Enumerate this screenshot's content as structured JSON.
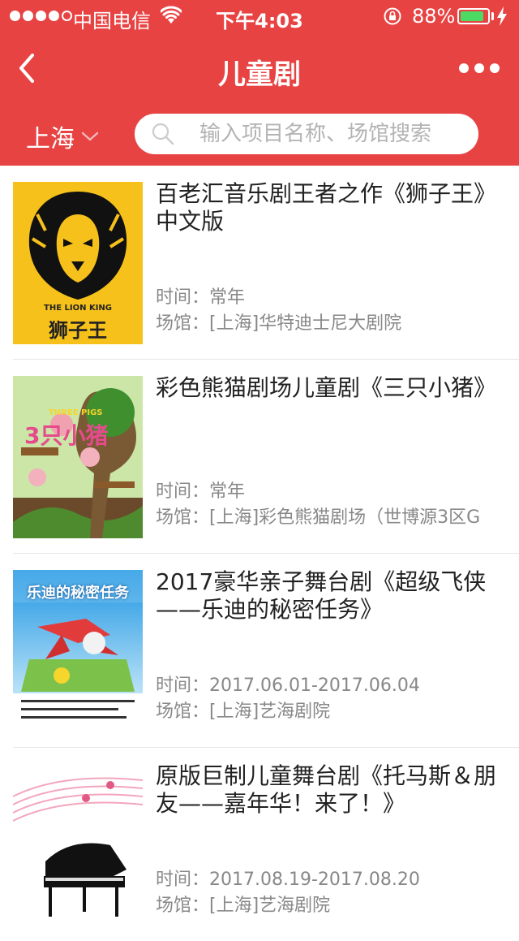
{
  "status_bar": {
    "carrier": "中国电信",
    "time": "下午4:03",
    "battery": "88%",
    "battery_level": 0.88
  },
  "nav": {
    "title": "儿童剧",
    "back_icon": "chevron-left-icon",
    "more_icon": "more-dots-icon"
  },
  "filter": {
    "city": "上海",
    "search_placeholder": "输入项目名称、场馆搜索"
  },
  "labels": {
    "time": "时间：",
    "venue": "场馆："
  },
  "items": [
    {
      "title": "百老汇音乐剧王者之作《狮子王》中文版",
      "time": "常年",
      "venue": "[上海]华特迪士尼大剧院",
      "poster_title": "狮子王",
      "poster_subtitle": "THE LION KING"
    },
    {
      "title": "彩色熊猫剧场儿童剧《三只小猪》",
      "time": "常年",
      "venue": "[上海]彩色熊猫剧场（世博源3区G",
      "poster_title": "3只小猪",
      "poster_subtitle": "THREE PIGS"
    },
    {
      "title": "2017豪华亲子舞台剧《超级飞侠——乐迪的秘密任务》",
      "time": "2017.06.01-2017.06.04",
      "venue": "[上海]艺海剧院",
      "poster_title": "乐迪的秘密任务"
    },
    {
      "title": "原版巨制儿童舞台剧《托马斯＆朋友——嘉年华！来了！》",
      "time": "2017.08.19-2017.08.20",
      "venue": "[上海]艺海剧院"
    }
  ],
  "colors": {
    "header": "#e84343",
    "battery_fill": "#4cd964"
  }
}
